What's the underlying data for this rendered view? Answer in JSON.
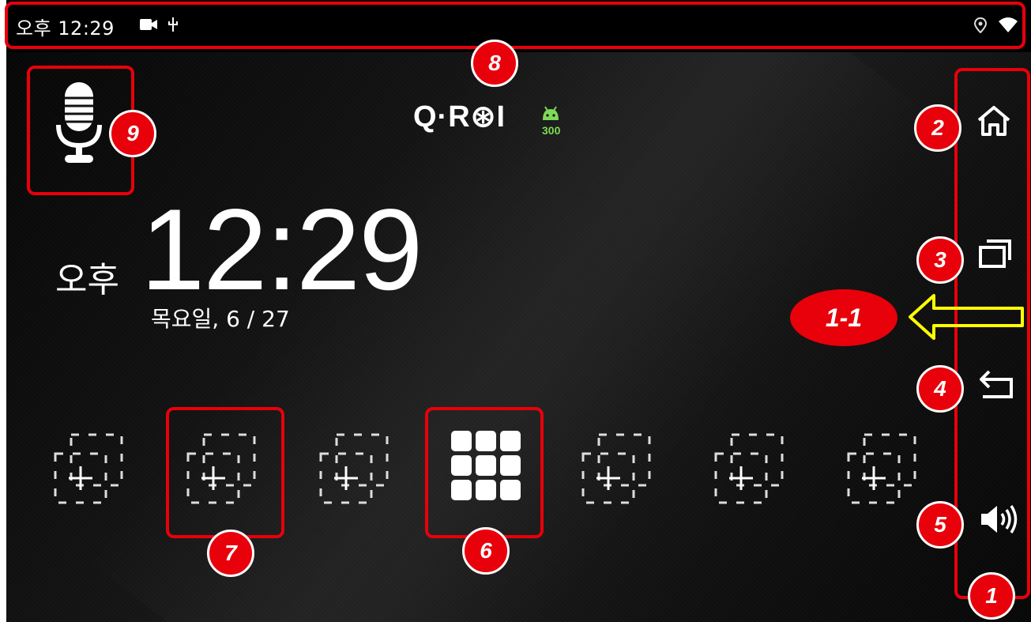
{
  "status_bar": {
    "time": "오후 12:29",
    "icons": [
      "video-icon",
      "usb-icon",
      "location-icon",
      "wifi-icon"
    ]
  },
  "logo": {
    "text": "Q·R⊛I",
    "badge_text": "300"
  },
  "clock": {
    "ampm": "오후",
    "time": "12:29",
    "date": "목요일, 6 / 27"
  },
  "dock": {
    "slots": [
      {
        "type": "empty",
        "icon": "add-shortcut-icon"
      },
      {
        "type": "empty",
        "icon": "add-shortcut-icon"
      },
      {
        "type": "empty",
        "icon": "add-shortcut-icon"
      },
      {
        "type": "apps",
        "icon": "app-grid-icon"
      },
      {
        "type": "empty",
        "icon": "add-shortcut-icon"
      },
      {
        "type": "empty",
        "icon": "add-shortcut-icon"
      },
      {
        "type": "empty",
        "icon": "add-shortcut-icon"
      }
    ]
  },
  "nav_bar": {
    "items": [
      {
        "name": "home",
        "icon": "home-icon"
      },
      {
        "name": "recents",
        "icon": "recents-icon"
      },
      {
        "name": "back",
        "icon": "back-icon"
      },
      {
        "name": "volume",
        "icon": "volume-icon"
      }
    ]
  },
  "annotations": {
    "badges": [
      "1",
      "2",
      "3",
      "4",
      "5",
      "6",
      "7",
      "8",
      "9"
    ],
    "callout": "1-1"
  },
  "colors": {
    "annotation_red": "#e8000b",
    "arrow_yellow": "#ffff00",
    "android_green": "#7ed957"
  }
}
